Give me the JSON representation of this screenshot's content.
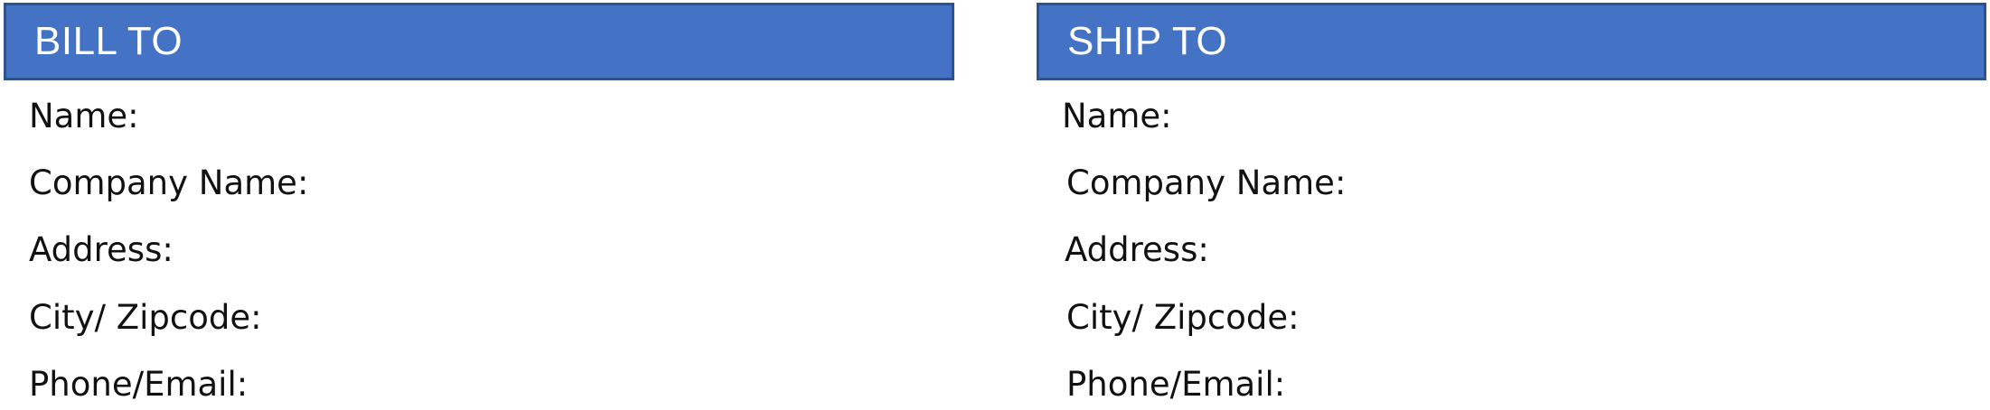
{
  "bill_to": {
    "title": "BILL TO",
    "fields": [
      "Name:",
      "Company Name:",
      "Address:",
      "City/ Zipcode:",
      "Phone/Email:"
    ]
  },
  "ship_to": {
    "title": "SHIP TO",
    "fields": [
      "Name:",
      "Company Name:",
      "Address:",
      "City/ Zipcode:",
      "Phone/Email:"
    ]
  },
  "colors": {
    "header_fill": "#4472c4",
    "header_border": "#2f528f",
    "header_text": "#ffffff",
    "body_text": "#111111"
  }
}
